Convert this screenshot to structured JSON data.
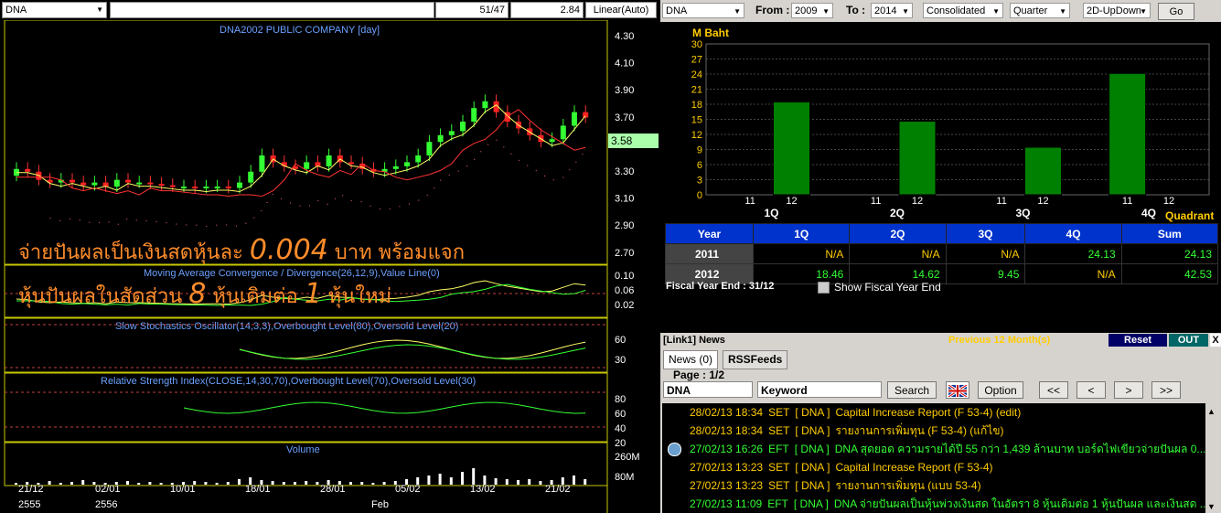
{
  "chart": {
    "symbol": "DNA",
    "counter": "51/47",
    "value": "2.84",
    "scale": "Linear(Auto)",
    "title": "DNA2002 PUBLIC COMPANY [day]",
    "last_price": "3.58",
    "price_ticks": [
      "4.30",
      "4.10",
      "3.90",
      "3.70",
      "3.50",
      "3.30",
      "3.10",
      "2.90",
      "2.70"
    ],
    "macd_title": "Moving Average Convergence / Divergence(26,12,9),Value Line(0)",
    "macd_ticks": [
      "0.10",
      "0.06",
      "0.02"
    ],
    "stoch_title": "Slow Stochastics Oscillator(14,3,3),Overbought Level(80),Oversold Level(20)",
    "stoch_ticks": [
      "60",
      "30"
    ],
    "rsi_title": "Relative Strength Index(CLOSE,14,30,70),Overbought Level(70),Oversold Level(30)",
    "rsi_ticks": [
      "80",
      "60",
      "40",
      "20"
    ],
    "volume_title": "Volume",
    "volume_ticks": [
      "260M",
      "80M"
    ],
    "dates": [
      "21/12",
      "02/01",
      "10/01",
      "18/01",
      "28/01",
      "05/02",
      "13/02",
      "21/02"
    ],
    "years": [
      "2555",
      "2556",
      "Feb"
    ],
    "overlay_line1_a": "จ่ายปันผลเป็นเงินสดหุ้นละ",
    "overlay_line1_b": "0.004",
    "overlay_line1_c": "บาท  พร้อมแจก",
    "overlay_line2_a": "หุ้นปันผลในสัดส่วน",
    "overlay_line2_b": "8",
    "overlay_line2_c": "หุ้นเดิมต่อ",
    "overlay_line2_d": "1",
    "overlay_line2_e": "หุ้นใหม่"
  },
  "fin": {
    "symbol": "DNA",
    "from_label": "From :",
    "from_value": "2009",
    "to_label": "To :",
    "to_value": "2014",
    "type": "Consolidated",
    "period": "Quarter",
    "view": "2D-UpDown",
    "go": "Go",
    "unit": "M Baht",
    "x_axis": "Quadrant",
    "columns": [
      "Year",
      "1Q",
      "2Q",
      "3Q",
      "4Q",
      "Sum"
    ],
    "rows": [
      {
        "year": "2011",
        "q1": "N/A",
        "q2": "N/A",
        "q3": "N/A",
        "q4": "24.13",
        "sum": "24.13"
      },
      {
        "year": "2012",
        "q1": "18.46",
        "q2": "14.62",
        "q3": "9.45",
        "q4": "N/A",
        "sum": "42.53"
      }
    ],
    "fiscal_label": "Fiscal  Year  End  :  31/12",
    "show_fye": "Show Fiscal Year End"
  },
  "chart_data": {
    "type": "bar",
    "categories": [
      "1Q",
      "2Q",
      "3Q",
      "4Q"
    ],
    "series": [
      {
        "name": "11",
        "values": [
          0,
          0,
          0,
          24.13
        ]
      },
      {
        "name": "12",
        "values": [
          18.46,
          14.62,
          9.45,
          0
        ]
      }
    ],
    "ylabel": "M Baht",
    "xlabel": "Quadrant",
    "ylim": [
      0,
      30
    ],
    "yticks": [
      0,
      3,
      6,
      9,
      12,
      15,
      18,
      21,
      24,
      27,
      30
    ],
    "grid": true,
    "bar_color": "#008000"
  },
  "news": {
    "header": "[Link1] News",
    "period": "Previous 12 Month(s)",
    "reset": "Reset",
    "out": "OUT",
    "close": "X",
    "tab_news": "News (0)",
    "tab_rss": "RSSFeeds",
    "page": "Page : 1/2",
    "symbol": "DNA",
    "keyword": "Keyword",
    "search": "Search",
    "option": "Option",
    "nav": [
      "<<",
      "<",
      ">",
      ">>"
    ],
    "items": [
      {
        "dt": "28/02/13 18:34",
        "src": "SET",
        "sym": "[ DNA ]",
        "title": "Capital Increase Report (F 53-4) (edit)",
        "color": "#ffcc00"
      },
      {
        "dt": "28/02/13 18:34",
        "src": "SET",
        "sym": "[ DNA ]",
        "title": "รายงานการเพิ่มทุน (F 53-4) (แก้ไข)",
        "color": "#ffcc00"
      },
      {
        "dt": "27/02/13 16:26",
        "src": "EFT",
        "sym": "[ DNA ]",
        "title": "DNA สุดยอด ความรายได้ปี 55 กว่า 1,439 ล้านบาท บอร์ดไฟเขียวจ่ายปันผล 0...",
        "color": "#33ff33"
      },
      {
        "dt": "27/02/13 13:23",
        "src": "SET",
        "sym": "[ DNA ]",
        "title": "Capital Increase Report (F 53-4)",
        "color": "#ffcc00"
      },
      {
        "dt": "27/02/13 13:23",
        "src": "SET",
        "sym": "[ DNA ]",
        "title": "รายงานการเพิ่มทุน (แบบ 53-4)",
        "color": "#ffcc00"
      },
      {
        "dt": "27/02/13 11:09",
        "src": "EFT",
        "sym": "[ DNA ]",
        "title": "DNA จ่ายปันผลเป็นหุ้นพ่วงเงินสด ในอัตรา 8 หุ้นเดิมต่อ 1 หุ้นปันผล และเงินสด ...",
        "color": "#33ff33"
      }
    ]
  }
}
